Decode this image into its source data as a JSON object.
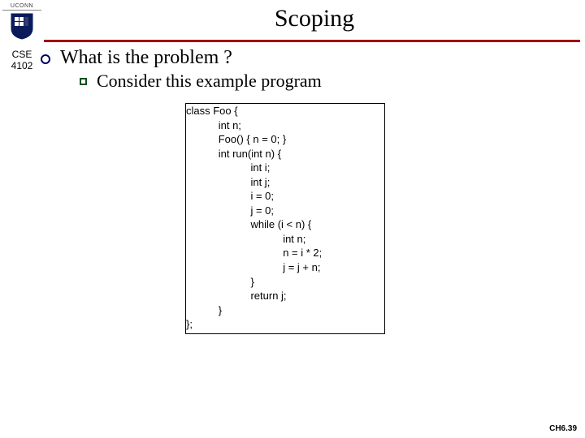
{
  "logo": {
    "label": "UCONN"
  },
  "side": {
    "line1": "CSE",
    "line2": "4102"
  },
  "title": "Scoping",
  "bullet": {
    "text": "What is the problem ?"
  },
  "sub": {
    "text": "Consider this example program"
  },
  "code": "class Foo {\n           int n;\n           Foo() { n = 0; }\n           int run(int n) {\n                      int i;\n                      int j;\n                      i = 0;\n                      j = 0;\n                      while (i < n) {\n                                 int n;\n                                 n = i * 2;\n                                 j = j + n;\n                      }\n                      return j;\n           }\n};",
  "footer": "CH6.39"
}
